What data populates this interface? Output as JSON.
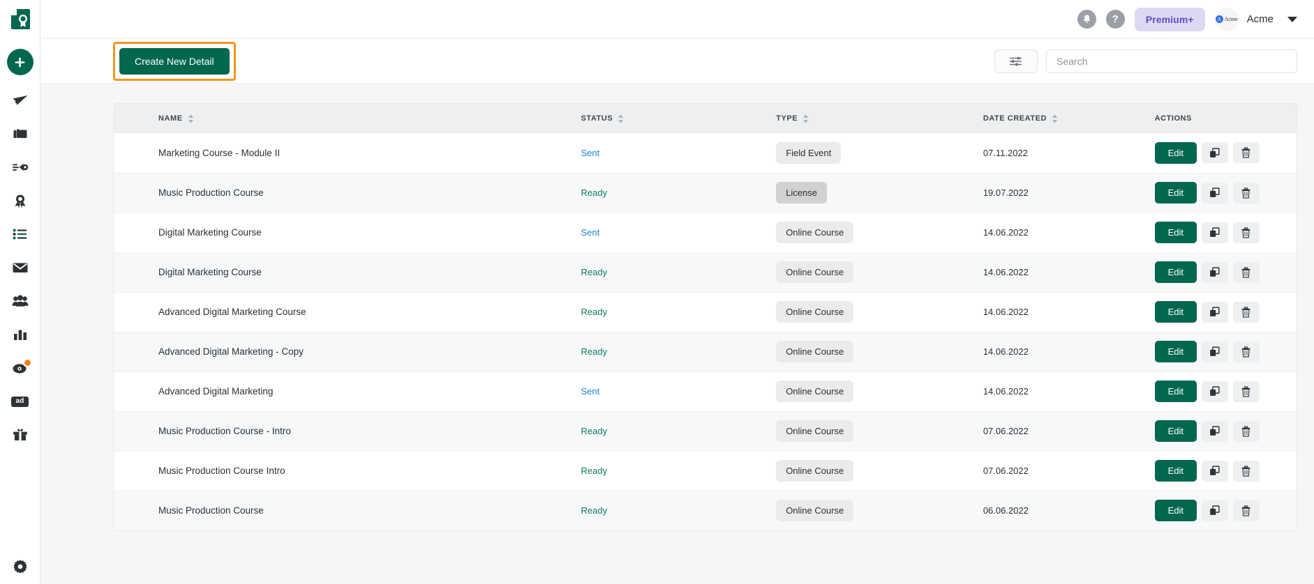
{
  "brand": {
    "logo_icon": "certificate-document-logo",
    "accent_green": "#03674f",
    "highlight_orange": "#f7941e"
  },
  "sidebar": {
    "add_button": {
      "label": "Add",
      "icon": "plus-icon"
    },
    "items": [
      {
        "name": "send",
        "icon": "paper-plane-icon",
        "label": "Send"
      },
      {
        "name": "campaigns",
        "icon": "layers-icon",
        "label": "Campaigns"
      },
      {
        "name": "automation",
        "icon": "automation-icon",
        "label": "Automation"
      },
      {
        "name": "details",
        "icon": "award-badge-icon",
        "label": "Details"
      },
      {
        "name": "lists",
        "icon": "list-icon",
        "label": "Lists"
      },
      {
        "name": "mail",
        "icon": "envelope-icon",
        "label": "Mail"
      },
      {
        "name": "audience",
        "icon": "people-group-icon",
        "label": "Audience"
      },
      {
        "name": "reports",
        "icon": "bar-chart-icon",
        "label": "Reports"
      },
      {
        "name": "discover",
        "icon": "compass-icon",
        "label": "Discover",
        "badge": true
      },
      {
        "name": "ads",
        "icon": "ad-chip-icon",
        "label": "ad"
      },
      {
        "name": "rewards",
        "icon": "gift-icon",
        "label": "Rewards"
      }
    ],
    "settings": {
      "icon": "gear-icon",
      "label": "Settings"
    }
  },
  "header": {
    "notifications": {
      "icon": "bell-icon",
      "label": "Notifications"
    },
    "help": {
      "icon": "question-mark-icon",
      "label": "Help"
    },
    "plan_badge": "Premium+",
    "avatar": {
      "icon": "acme-avatar",
      "mark": "A",
      "mark_label": "Acme"
    },
    "org_name": "Acme",
    "chevron": "chevron-down-icon"
  },
  "toolbar": {
    "create_label": "Create New Detail",
    "filter": {
      "icon": "sliders-filter-icon",
      "label": "Filter"
    },
    "search": {
      "value": "",
      "placeholder": "Search"
    }
  },
  "table": {
    "columns": [
      {
        "key": "name",
        "label": "NAME",
        "sortable": true
      },
      {
        "key": "status",
        "label": "STATUS",
        "sortable": true
      },
      {
        "key": "type",
        "label": "TYPE",
        "sortable": true
      },
      {
        "key": "date",
        "label": "DATE CREATED",
        "sortable": true
      },
      {
        "key": "actions",
        "label": "ACTIONS",
        "sortable": false
      }
    ],
    "row_actions": {
      "edit_label": "Edit",
      "duplicate_icon": "copy-duplicate-icon",
      "delete_icon": "trash-delete-icon"
    },
    "rows": [
      {
        "name": "Marketing Course - Module II",
        "status": "Sent",
        "status_kind": "sent",
        "type": "Field Event",
        "type_kind": "dark-light",
        "date": "07.11.2022"
      },
      {
        "name": "Music Production Course",
        "status": "Ready",
        "status_kind": "ready",
        "type": "License",
        "type_kind": "dark",
        "date": "19.07.2022"
      },
      {
        "name": "Digital Marketing Course",
        "status": "Sent",
        "status_kind": "sent",
        "type": "Online Course",
        "type_kind": "light",
        "date": "14.06.2022"
      },
      {
        "name": "Digital Marketing Course",
        "status": "Ready",
        "status_kind": "ready",
        "type": "Online Course",
        "type_kind": "light",
        "date": "14.06.2022"
      },
      {
        "name": "Advanced Digital Marketing Course",
        "status": "Ready",
        "status_kind": "ready",
        "type": "Online Course",
        "type_kind": "light",
        "date": "14.06.2022"
      },
      {
        "name": "Advanced Digital Marketing - Copy",
        "status": "Ready",
        "status_kind": "ready",
        "type": "Online Course",
        "type_kind": "light",
        "date": "14.06.2022"
      },
      {
        "name": "Advanced Digital Marketing",
        "status": "Sent",
        "status_kind": "sent",
        "type": "Online Course",
        "type_kind": "light",
        "date": "14.06.2022"
      },
      {
        "name": "Music Production Course - Intro",
        "status": "Ready",
        "status_kind": "ready",
        "type": "Online Course",
        "type_kind": "light",
        "date": "07.06.2022"
      },
      {
        "name": "Music Production Course Intro",
        "status": "Ready",
        "status_kind": "ready",
        "type": "Online Course",
        "type_kind": "light",
        "date": "07.06.2022"
      },
      {
        "name": "Music Production Course",
        "status": "Ready",
        "status_kind": "ready",
        "type": "Online Course",
        "type_kind": "light",
        "date": "06.06.2022"
      }
    ]
  }
}
